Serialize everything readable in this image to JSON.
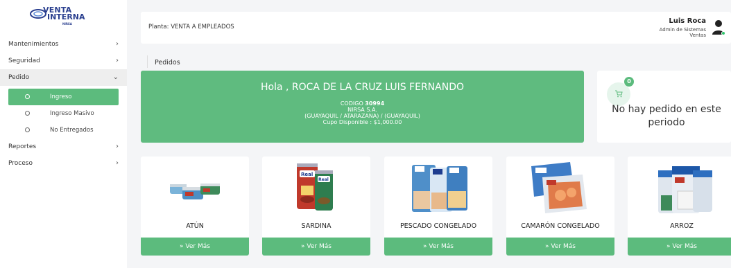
{
  "logo": {
    "line1": "VENTA",
    "line2": "INTERNA",
    "line3": "NIRSA"
  },
  "sidebar": {
    "items": [
      {
        "label": "Mantenimientos",
        "chevron": "chevron-right-icon"
      },
      {
        "label": "Seguridad",
        "chevron": "chevron-right-icon"
      },
      {
        "label": "Pedido",
        "chevron": "chevron-down-icon"
      },
      {
        "label": "Reportes",
        "chevron": "chevron-right-icon"
      },
      {
        "label": "Proceso",
        "chevron": "chevron-right-icon"
      }
    ],
    "subitems": [
      {
        "label": "Ingreso",
        "active": true
      },
      {
        "label": "Ingreso Masivo",
        "active": false
      },
      {
        "label": "No Entregados",
        "active": false
      }
    ]
  },
  "header": {
    "planta": "Planta: VENTA A EMPLEADOS",
    "user_name": "Luis Roca",
    "user_role_line1": "Admin de Sistemas",
    "user_role_line2": "Ventas"
  },
  "breadcrumb": "Pedidos",
  "banner": {
    "greeting": "Hola , ROCA DE LA CRUZ LUIS FERNANDO",
    "codigo_label": "CODIGO",
    "codigo_value": "30994",
    "company": "NIRSA S.A.",
    "location": "(GUAYAQUIL / ATARAZANA) / (GUAYAQUIL)",
    "cupo": "Cupo Disponible : $1,000.00"
  },
  "cart": {
    "count": "0",
    "message": "No hay pedido en este periodo",
    "icon": "cart-icon"
  },
  "products": [
    {
      "name": "ATÚN",
      "button": "» Ver Más"
    },
    {
      "name": "SARDINA",
      "button": "» Ver Más"
    },
    {
      "name": "PESCADO CONGELADO",
      "button": "» Ver Más"
    },
    {
      "name": "CAMARÓN CONGELADO",
      "button": "» Ver Más"
    },
    {
      "name": "ARROZ",
      "button": "» Ver Más"
    }
  ],
  "colors": {
    "accent": "#5cbb7d",
    "brand_blue": "#2a3f8f"
  }
}
